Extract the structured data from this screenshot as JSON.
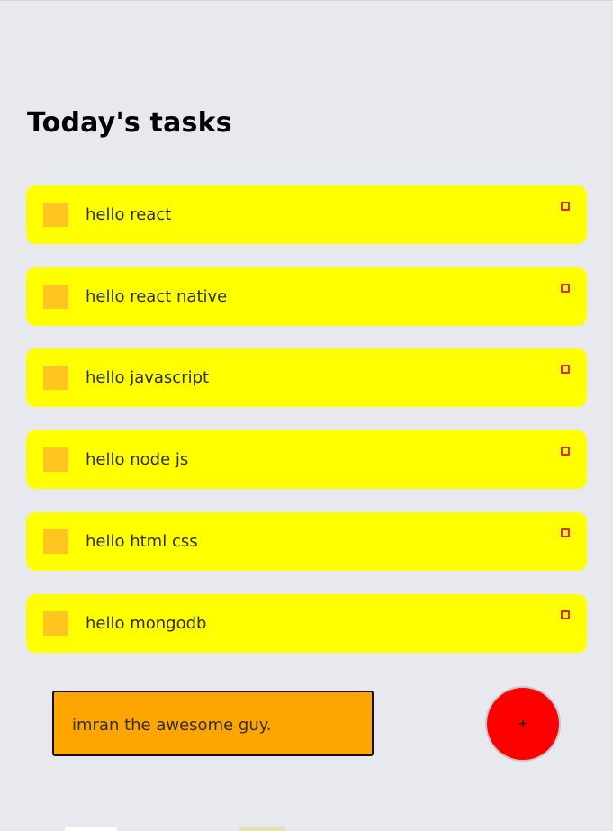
{
  "page": {
    "title": "Today's tasks"
  },
  "tasks": [
    {
      "label": "hello react"
    },
    {
      "label": "hello react native"
    },
    {
      "label": "hello javascript"
    },
    {
      "label": "hello node js"
    },
    {
      "label": "hello html css"
    },
    {
      "label": "hello mongodb"
    }
  ],
  "composer": {
    "input_value": "imran the awesome guy.",
    "add_label": "+"
  },
  "colors": {
    "background": "#e8e9ee",
    "task_bg": "#ffff00",
    "task_square": "#ffc41f",
    "task_circle_border": "#e3233f",
    "input_bg": "#ffa500",
    "add_button_bg": "#ff0000"
  }
}
